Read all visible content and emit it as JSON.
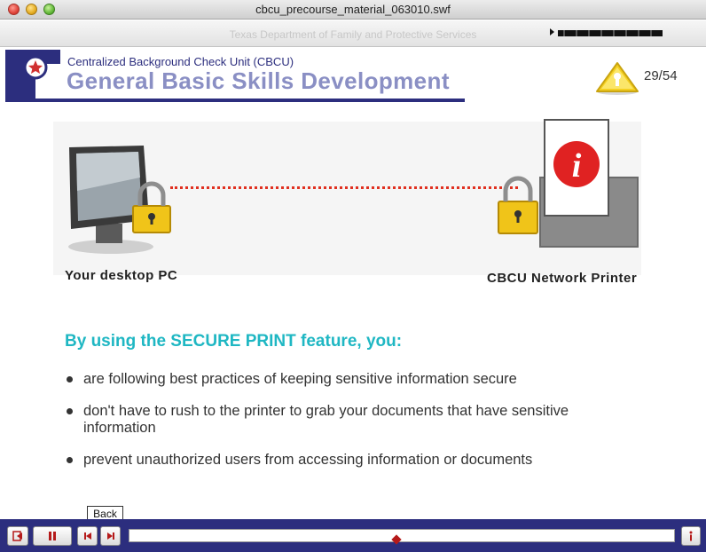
{
  "window": {
    "title": "cbcu_precourse_material_063010.swf"
  },
  "course_strip": {
    "agency": "Texas Department of Family and Protective Services"
  },
  "header": {
    "subtitle": "Centralized Background Check Unit (CBCU)",
    "title": "General Basic Skills Development",
    "page_counter": "29/54"
  },
  "diagram": {
    "pc_label": "Your desktop PC",
    "printer_label": "CBCU Network Printer",
    "printer_icon": "info-icon",
    "lock_icon": "padlock-icon",
    "connector_color": "#e03020"
  },
  "content": {
    "headline": "By using the SECURE PRINT feature, you:",
    "bullets": [
      "are following best practices of keeping sensitive information secure",
      "don't have to rush to the printer to grab your documents that have sensitive information",
      "prevent unauthorized users from accessing information or documents"
    ]
  },
  "player": {
    "tooltip": "Back",
    "exit_icon": "exit-icon",
    "pause_icon": "pause-icon",
    "back_icon": "skip-back-icon",
    "forward_icon": "skip-forward-icon",
    "info_icon": "info-icon",
    "progress": 0.49
  },
  "colors": {
    "brand_navy": "#2c2e7e",
    "title_lavender": "#8a8fc4",
    "headline_teal": "#1fb7c3",
    "accent_red": "#b51a1a"
  }
}
